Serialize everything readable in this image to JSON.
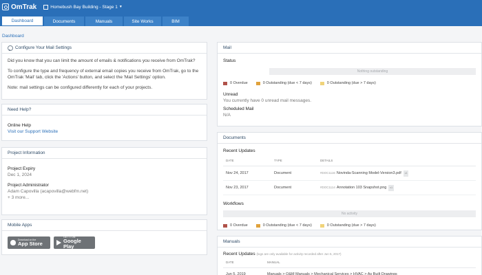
{
  "app": {
    "name": "OmTrak",
    "project": "Homebush Bay Building - Stage 1"
  },
  "tabs": [
    "Dashboard",
    "Documents",
    "Manuals",
    "Site Works",
    "BIM"
  ],
  "breadcrumb": "Dashboard",
  "mail_settings": {
    "title": "Configure Your Mail Settings",
    "p1": "Did you know that you can limit the amount of emails & notifications you receive from OmTrak?",
    "p2": "To configure the type and frequency of external email copies you receive from OmTrak, go to the OmTrak 'Mail' tab, click the 'Actions' button, and select the 'Mail Settings' option.",
    "p3": "Note: mail settings can be configured differently for each of your projects."
  },
  "help": {
    "title": "Need Help?",
    "item_title": "Online Help",
    "item_link": "Visit our Support Website"
  },
  "project_info": {
    "title": "Project Information",
    "expiry_label": "Project Expiry",
    "expiry_value": "Dec 1, 2024",
    "admin_label": "Project Administrator",
    "admin_value": "Adam Capovilla (acapovilla@webfm.net)",
    "more": "+ 3 more..."
  },
  "mobile": {
    "title": "Mobile Apps",
    "appstore_small": "Download on the",
    "appstore_big": "App Store",
    "play_small": "GET IT ON",
    "play_big": "Google Play"
  },
  "mail": {
    "title": "Mail",
    "status_label": "Status",
    "status_bar": "Nothing outstanding",
    "legend": [
      "0 Overdue",
      "0 Outstanding (due < 7 days)",
      "0 Outstanding (due > 7 days)"
    ],
    "unread_label": "Unread",
    "unread_value": "You currently have 0 unread mail messages.",
    "scheduled_label": "Scheduled Mail",
    "scheduled_value": "N/A"
  },
  "documents": {
    "title": "Documents",
    "recent_label": "Recent Updates",
    "columns": [
      "DATE",
      "TYPE",
      "DETAILS"
    ],
    "rows": [
      {
        "date": "Nov 24, 2017",
        "type": "Document",
        "code": "#DOC1116",
        "detail": "Novinda-Scanning Model-Version3.pdf",
        "tag": "v1"
      },
      {
        "date": "Nov 23, 2017",
        "type": "Document",
        "code": "#DOC1114",
        "detail": "Annotation 103 Snapshot.png",
        "tag": "v1"
      }
    ],
    "workflows_label": "Workflows",
    "workflows_bar": "No activity",
    "legend": [
      "0 Overdue",
      "0 Outstanding (due < 7 days)",
      "0 Outstanding (due > 7 days)"
    ]
  },
  "manuals": {
    "title": "Manuals",
    "recent_label": "Recent Updates",
    "recent_note": "(logs are only available for activity recorded after Jun 5, 2017)",
    "columns": [
      "DATE",
      "MANUAL"
    ],
    "rows": [
      {
        "date": "Jun 5, 2019",
        "manual": "Manuals > O&M Manuals > Mechanical Services > HVAC > As Built Drawings"
      }
    ]
  },
  "colors": {
    "brand": "#2a6fb8",
    "overdue": "#b0524a",
    "due_soon": "#e0a23c",
    "due_later": "#f0d37a"
  }
}
